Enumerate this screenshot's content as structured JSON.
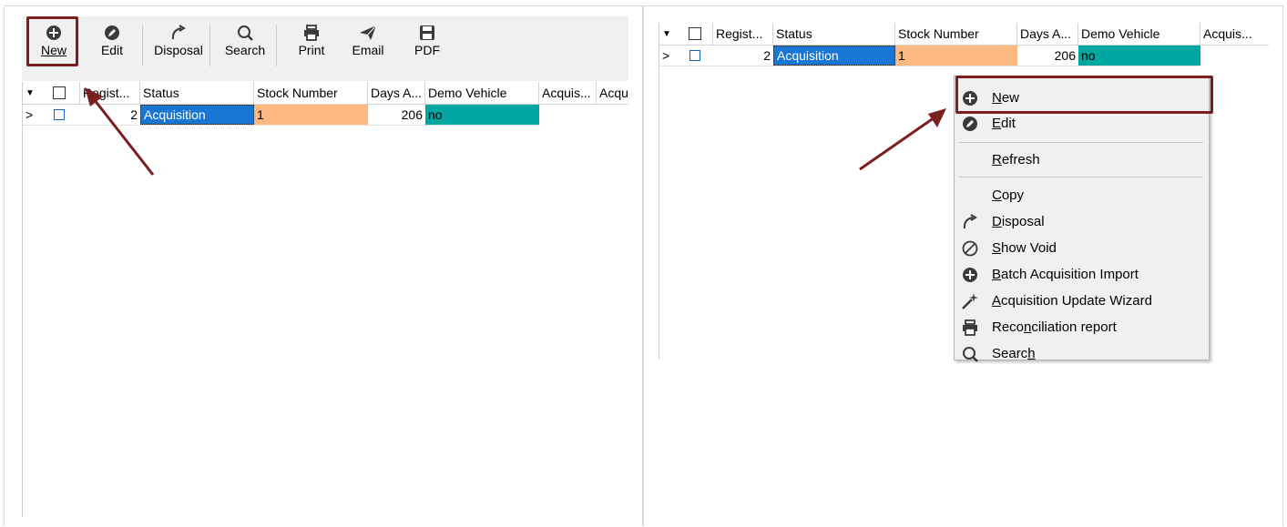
{
  "toolbar": {
    "buttons": [
      {
        "label": "New",
        "icon": "plus-circle-icon"
      },
      {
        "label": "Edit",
        "icon": "pencil-circle-icon"
      },
      {
        "label": "Disposal",
        "icon": "curved-arrow-icon"
      },
      {
        "label": "Search",
        "icon": "magnifier-icon"
      },
      {
        "label": "Print",
        "icon": "printer-icon"
      },
      {
        "label": "Email",
        "icon": "paper-plane-icon"
      },
      {
        "label": "PDF",
        "icon": "floppy-disk-icon"
      }
    ]
  },
  "grid_left": {
    "columns": [
      "Regist...",
      "Status",
      "Stock Number",
      "Days A...",
      "Demo Vehicle",
      "Acquis...",
      "Acqu"
    ],
    "row": {
      "regist": "2",
      "status": "Acquisition",
      "stock": "1",
      "days": "206",
      "demo": "no"
    }
  },
  "grid_right": {
    "columns": [
      "Regist...",
      "Status",
      "Stock Number",
      "Days A...",
      "Demo Vehicle",
      "Acquis..."
    ],
    "row": {
      "regist": "2",
      "status": "Acquisition",
      "stock": "1",
      "days": "206",
      "demo": "no"
    }
  },
  "context_menu": {
    "items": [
      {
        "label": "New",
        "underline_index": 0,
        "icon": "plus-circle-icon"
      },
      {
        "label": "Edit",
        "underline_index": 0,
        "icon": "pencil-circle-icon"
      },
      {
        "label": "Refresh",
        "underline_index": 0,
        "icon": ""
      },
      {
        "label": "Copy",
        "underline_index": 0,
        "icon": ""
      },
      {
        "label": "Disposal",
        "underline_index": 0,
        "icon": "curved-arrow-icon"
      },
      {
        "label": "Show Void",
        "underline_index": 0,
        "icon": "void-circle-icon"
      },
      {
        "label": "Batch Acquisition Import",
        "underline_index": 0,
        "icon": "plus-circle-icon"
      },
      {
        "label": "Acquisition Update Wizard",
        "underline_index": 0,
        "icon": "magic-wand-icon"
      },
      {
        "label": "Reconciliation report",
        "underline_index": 4,
        "icon": "printer-icon"
      },
      {
        "label": "Search",
        "underline_index": 5,
        "icon": "magnifier-icon"
      }
    ]
  },
  "colors": {
    "highlight_border": "#7b1e1e",
    "status_selected": "#1976d2",
    "stock_cell": "#ffb980",
    "demo_cell": "#00a6a0",
    "checkbox_blue": "#1565c0"
  }
}
